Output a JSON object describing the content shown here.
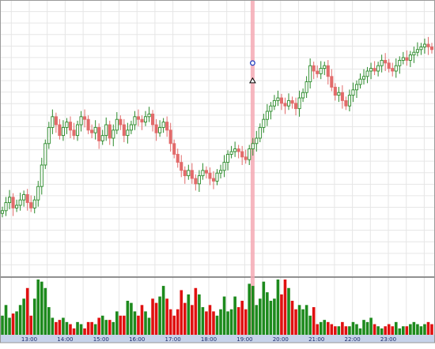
{
  "chart_data": [
    {
      "type": "candlestick",
      "panel": "price",
      "x_tick_labels": [
        "13:00",
        "14:00",
        "15:00",
        "16:00",
        "17:00",
        "18:00",
        "19:00",
        "20:00",
        "21:00",
        "22:00",
        "23:00"
      ],
      "grid": true,
      "price_range": [
        0,
        100
      ],
      "colors": {
        "up": "#2a8a2a",
        "down": "#e26b6b",
        "highlight_band": "#f4a9b4",
        "axis_bar": "#c7d3ea",
        "axis_text": "#1a2a6a",
        "marker_circle": "#2040c0"
      },
      "highlighted_time": "19:00",
      "markers": [
        {
          "type": "circle",
          "time": "19:00",
          "price": 78.0
        },
        {
          "type": "triangle",
          "time": "19:00",
          "price": 71.5
        }
      ],
      "closes": [
        23,
        26,
        28,
        24,
        25,
        27,
        29,
        26,
        24,
        27,
        32,
        40,
        48,
        54,
        58,
        55,
        51,
        54,
        56,
        53,
        51,
        55,
        58,
        57,
        53,
        52,
        54,
        49,
        51,
        55,
        50,
        53,
        57,
        55,
        51,
        53,
        55,
        58,
        57,
        56,
        58,
        59,
        55,
        52,
        54,
        56,
        53,
        48,
        44,
        41,
        38,
        36,
        38,
        35,
        33,
        36,
        38,
        37,
        35,
        34,
        37,
        38,
        41,
        44,
        45,
        46,
        45,
        43,
        42,
        46,
        48,
        50,
        54,
        57,
        60,
        62,
        64,
        65,
        63,
        62,
        64,
        63,
        61,
        65,
        67,
        71,
        77,
        75,
        74,
        76,
        77,
        73,
        69,
        66,
        67,
        64,
        62,
        66,
        68,
        70,
        72,
        73,
        75,
        76,
        75,
        77,
        79,
        78,
        76,
        75,
        77,
        79,
        80,
        79,
        81,
        82,
        83,
        84,
        85,
        84,
        83
      ]
    },
    {
      "type": "bar",
      "panel": "volume",
      "x_tick_labels": [
        "13:00",
        "14:00",
        "15:00",
        "16:00",
        "17:00",
        "18:00",
        "19:00",
        "20:00",
        "21:00",
        "22:00",
        "23:00"
      ],
      "values": [
        9,
        14,
        8,
        10,
        11,
        14,
        17,
        22,
        9,
        17,
        26,
        25,
        22,
        13,
        8,
        6,
        7,
        8,
        6,
        5,
        3,
        6,
        5,
        3,
        6,
        6,
        5,
        8,
        9,
        7,
        7,
        6,
        11,
        9,
        9,
        16,
        15,
        11,
        9,
        14,
        11,
        8,
        17,
        15,
        18,
        23,
        17,
        12,
        9,
        12,
        21,
        15,
        19,
        14,
        22,
        19,
        13,
        11,
        14,
        11,
        9,
        12,
        18,
        11,
        12,
        18,
        13,
        16,
        12,
        24,
        23,
        14,
        17,
        25,
        20,
        16,
        17,
        26,
        19,
        26,
        22,
        16,
        12,
        14,
        12,
        14,
        9,
        13,
        5,
        6,
        7,
        6,
        5,
        4,
        4,
        6,
        4,
        4,
        6,
        5,
        3,
        7,
        6,
        8,
        5,
        4,
        3,
        4,
        5,
        4,
        6,
        3,
        4,
        4,
        5,
        6,
        5,
        4,
        5,
        6,
        5
      ],
      "colors": {
        "up": "#1d8a1d",
        "down": "#e01010"
      }
    }
  ]
}
